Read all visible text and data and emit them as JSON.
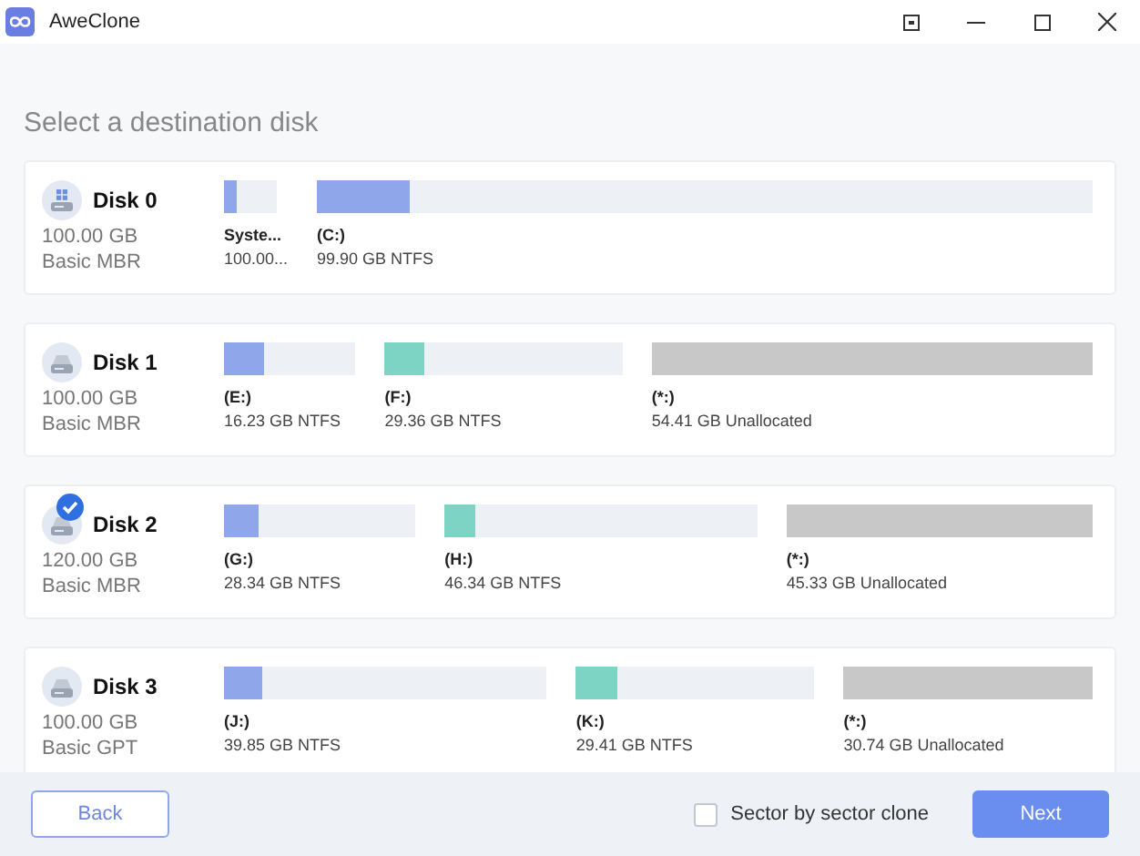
{
  "window": {
    "title": "AweClone"
  },
  "heading": "Select a destination disk",
  "disks": [
    {
      "name": "Disk 0",
      "kind": "system",
      "capacity": "100.00 GB",
      "type": "Basic MBR",
      "selected": false,
      "partitions": [
        {
          "kind": "system",
          "label": "Syste...",
          "detail": "100.00...",
          "level": 0.25
        },
        {
          "kind": "data",
          "label": "(C:)",
          "detail": "99.90 GB NTFS",
          "level": 0.12
        }
      ]
    },
    {
      "name": "Disk 1",
      "kind": "data",
      "capacity": "100.00 GB",
      "type": "Basic MBR",
      "selected": false,
      "partitions": [
        {
          "kind": "data",
          "label": "(E:)",
          "detail": "16.23 GB NTFS",
          "level": 0.3
        },
        {
          "kind": "data",
          "label": "(F:)",
          "detail": "29.36 GB NTFS",
          "level": 0.17
        },
        {
          "kind": "unallocated",
          "label": "(*:)",
          "detail": "54.41 GB Unallocated"
        }
      ]
    },
    {
      "name": "Disk 2",
      "kind": "data",
      "capacity": "120.00 GB",
      "type": "Basic MBR",
      "selected": true,
      "partitions": [
        {
          "kind": "data",
          "label": "(G:)",
          "detail": "28.34 GB NTFS",
          "level": 0.18
        },
        {
          "kind": "data",
          "label": "(H:)",
          "detail": "46.34 GB NTFS",
          "level": 0.1
        },
        {
          "kind": "unallocated",
          "label": "(*:)",
          "detail": "45.33 GB Unallocated"
        }
      ]
    },
    {
      "name": "Disk 3",
      "kind": "data",
      "capacity": "100.00 GB",
      "type": "Basic GPT",
      "selected": false,
      "partitions": [
        {
          "kind": "data",
          "label": "(J:)",
          "detail": "39.85 GB NTFS",
          "level": 0.12
        },
        {
          "kind": "data",
          "label": "(K:)",
          "detail": "29.41 GB NTFS",
          "level": 0.17
        },
        {
          "kind": "unallocated",
          "label": "(*:)",
          "detail": "30.74 GB Unallocated"
        }
      ]
    }
  ],
  "footer": {
    "back": "Back",
    "sector_clone": {
      "label": "Sector by sector clone",
      "checked": false
    },
    "next": "Next"
  }
}
